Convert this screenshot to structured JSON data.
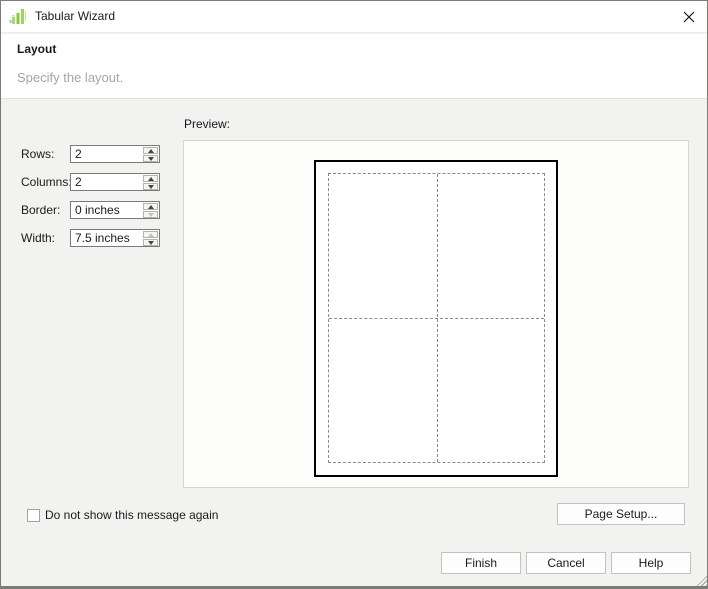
{
  "window": {
    "title": "Tabular Wizard"
  },
  "header": {
    "title": "Layout",
    "subtitle": "Specify the layout."
  },
  "form": {
    "fields": [
      {
        "label": "Rows:",
        "value": "2"
      },
      {
        "label": "Columns:",
        "value": "2"
      },
      {
        "label": "Border:",
        "value": "0 inches"
      },
      {
        "label": "Width:",
        "value": "7.5 inches"
      }
    ]
  },
  "preview": {
    "label": "Preview:",
    "rows": 2,
    "columns": 2
  },
  "checkbox": {
    "label": "Do not show this message again",
    "checked": false
  },
  "buttons": {
    "page_setup": "Page Setup...",
    "finish": "Finish",
    "cancel": "Cancel",
    "help": "Help"
  },
  "colors": {
    "icon_green": "#8cc63f",
    "icon_green_light": "#a8d977",
    "body_bg": "#f2f3f0",
    "preview_bg": "#fdfdfb",
    "page_border": "#000000",
    "grid_dash": "#8a8a8a"
  }
}
